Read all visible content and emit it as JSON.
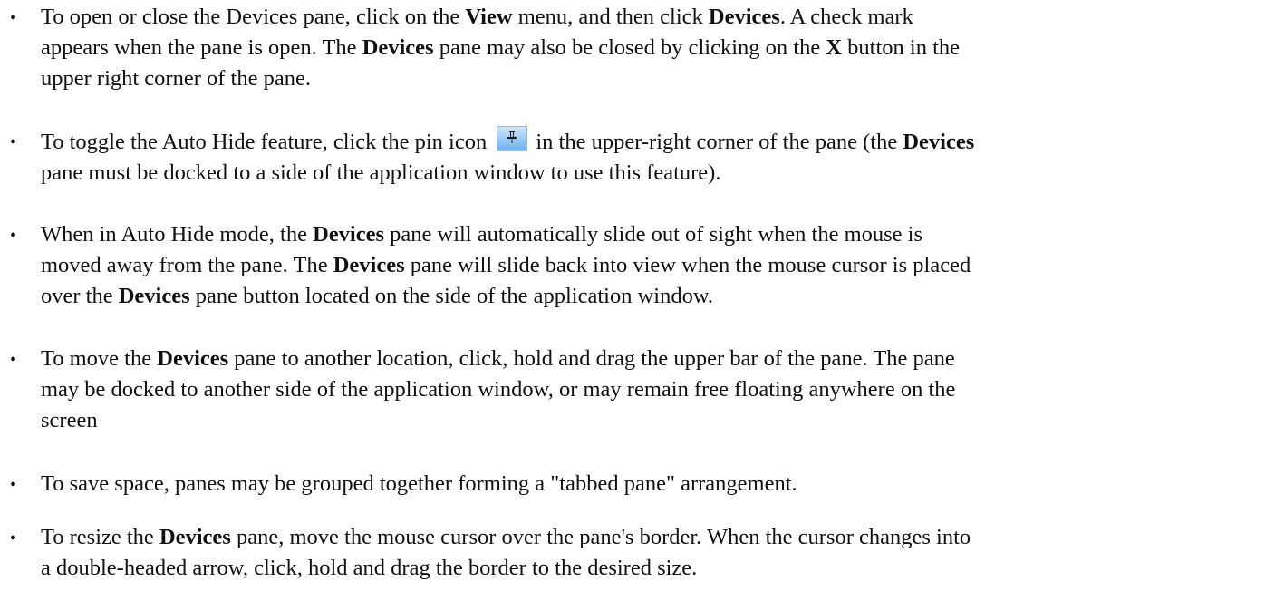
{
  "bullets": [
    {
      "lines": [
        [
          "To open or close the Devices pane, click on the ",
          {
            "b": "View"
          },
          " menu, and then click ",
          {
            "b": "Devices"
          },
          ". A check mark"
        ],
        [
          "appears when the pane is open. The ",
          {
            "b": "Devices"
          },
          " pane may also be closed by clicking on the ",
          {
            "b": "X"
          },
          " button in the"
        ],
        [
          "upper right corner of the pane."
        ]
      ]
    },
    {
      "lines": [
        [
          "To toggle the Auto Hide feature, click the pin icon ",
          {
            "icon": "pin-icon"
          },
          "in the upper-right corner of the pane (the ",
          {
            "b": "Devices"
          }
        ],
        [
          "pane must be docked to a side of the application window to use this feature)."
        ]
      ]
    },
    {
      "lines": [
        [
          "When in Auto Hide mode, the ",
          {
            "b": "Devices"
          },
          " pane will automatically slide out of sight when the mouse is"
        ],
        [
          "moved away from the pane. The ",
          {
            "b": "Devices"
          },
          " pane will slide back into view when the mouse cursor is placed"
        ],
        [
          "over the ",
          {
            "b": "Devices"
          },
          " pane button located on the side of the application window."
        ]
      ]
    },
    {
      "lines": [
        [
          "To move the ",
          {
            "b": "Devices"
          },
          " pane to another location, click, hold and drag the upper bar of the pane. The pane"
        ],
        [
          "may be docked to another side of the application window, or may remain free floating anywhere on the"
        ],
        [
          "screen"
        ]
      ]
    },
    {
      "lines": [
        [
          "To save space, panes may be grouped together forming a \"tabbed pane\" arrangement."
        ]
      ]
    },
    {
      "lines": [
        [
          "To resize the ",
          {
            "b": "Devices"
          },
          " pane, move the mouse cursor over the pane's border. When the cursor changes into"
        ],
        [
          "a double-headed arrow, click, hold and drag the border to the desired size."
        ]
      ]
    }
  ],
  "bullet_symbol": "•",
  "colors": {
    "text": "#111111",
    "pin_icon_light": "#cfe5fb",
    "pin_icon_dark": "#6fb1ef"
  }
}
